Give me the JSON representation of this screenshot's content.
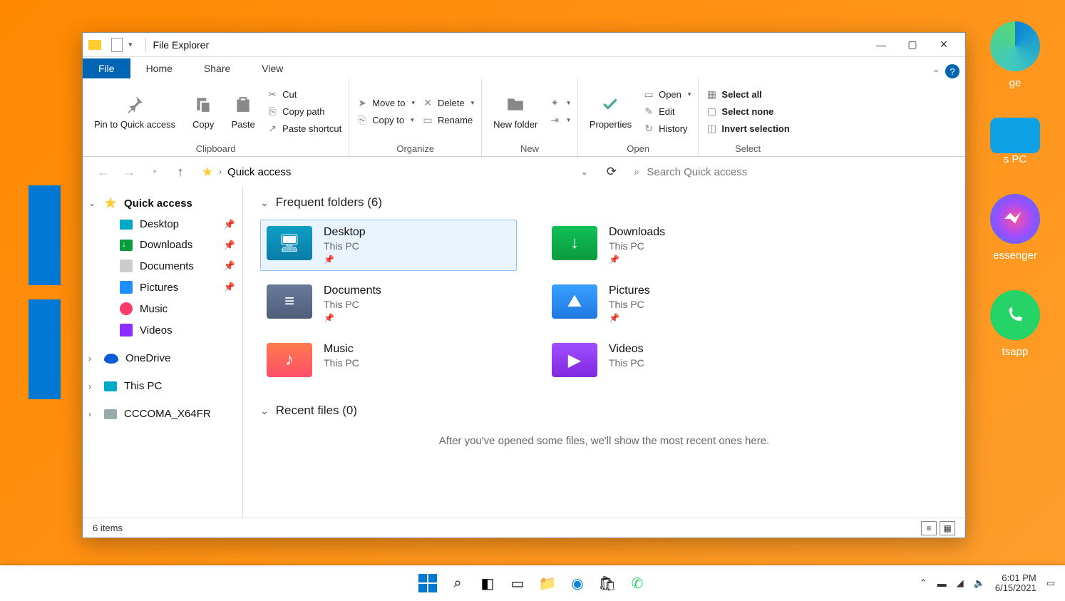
{
  "window": {
    "title": "File Explorer",
    "tabs": {
      "file": "File",
      "home": "Home",
      "share": "Share",
      "view": "View"
    }
  },
  "ribbon": {
    "clipboard": {
      "label": "Clipboard",
      "pin": "Pin to Quick access",
      "copy": "Copy",
      "paste": "Paste",
      "cut": "Cut",
      "copypath": "Copy path",
      "pasteshortcut": "Paste shortcut"
    },
    "organize": {
      "label": "Organize",
      "moveto": "Move to",
      "copyto": "Copy to",
      "delete": "Delete",
      "rename": "Rename"
    },
    "new": {
      "label": "New",
      "newfolder": "New folder"
    },
    "open": {
      "label": "Open",
      "properties": "Properties",
      "open": "Open",
      "edit": "Edit",
      "history": "History"
    },
    "select": {
      "label": "Select",
      "all": "Select all",
      "none": "Select none",
      "invert": "Invert selection"
    }
  },
  "address": {
    "location": "Quick access",
    "search_placeholder": "Search Quick access"
  },
  "sidebar": {
    "quick": "Quick access",
    "desktop": "Desktop",
    "downloads": "Downloads",
    "documents": "Documents",
    "pictures": "Pictures",
    "music": "Music",
    "videos": "Videos",
    "onedrive": "OneDrive",
    "thispc": "This PC",
    "drive": "CCCOMA_X64FR"
  },
  "content": {
    "frequent_head": "Frequent folders (6)",
    "recent_head": "Recent files (0)",
    "recent_msg": "After you've opened some files, we'll show the most recent ones here.",
    "loc": "This PC",
    "folders": {
      "desktop": "Desktop",
      "downloads": "Downloads",
      "documents": "Documents",
      "pictures": "Pictures",
      "music": "Music",
      "videos": "Videos"
    }
  },
  "status": {
    "items": "6 items"
  },
  "desktop_labels": {
    "edge": "ge",
    "thispc": "s PC",
    "messenger": "essenger",
    "whatsapp": "tsapp"
  },
  "clock": {
    "time": "6:01 PM",
    "date": "6/15/2021"
  }
}
